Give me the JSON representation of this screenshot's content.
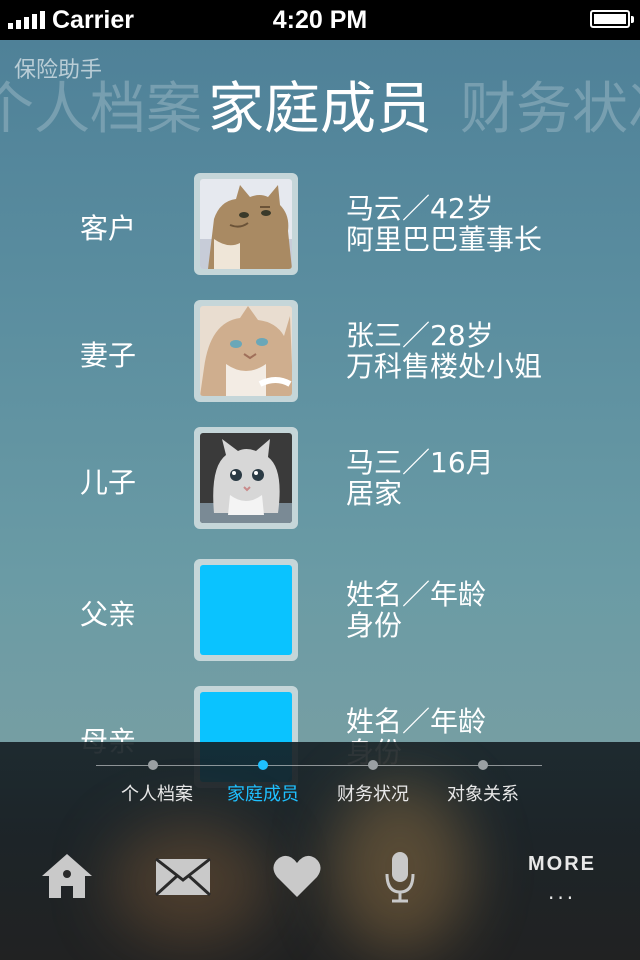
{
  "status_bar": {
    "carrier": "Carrier",
    "time": "4:20 PM"
  },
  "app_title": "保险助手",
  "header_tabs": {
    "prev": "个人档案",
    "current": "家庭成员",
    "next": "财务状况"
  },
  "members": [
    {
      "role": "客户",
      "name_age": "马云／42岁",
      "identity": "阿里巴巴董事长",
      "photo": "cat-photo-1"
    },
    {
      "role": "妻子",
      "name_age": "张三／28岁",
      "identity": "万科售楼处小姐",
      "photo": "cat-photo-2"
    },
    {
      "role": "儿子",
      "name_age": "马三／16月",
      "identity": "居家",
      "photo": "kitten-photo"
    },
    {
      "role": "父亲",
      "name_age": "姓名／年龄",
      "identity": "身份",
      "photo": "placeholder"
    },
    {
      "role": "母亲",
      "name_age": "姓名／年龄",
      "identity": "身份",
      "photo": "placeholder"
    }
  ],
  "pager": {
    "items": [
      "个人档案",
      "家庭成员",
      "财务状况",
      "对象关系"
    ],
    "active_index": 1
  },
  "toolbar": {
    "items": [
      "home-icon",
      "mail-icon",
      "heart-icon",
      "microphone-icon"
    ],
    "more_label": "MORE",
    "more_dots": "..."
  },
  "colors": {
    "accent": "#1ec0ff",
    "placeholder": "#0ac3ff",
    "frame": "#c5d6d9"
  }
}
